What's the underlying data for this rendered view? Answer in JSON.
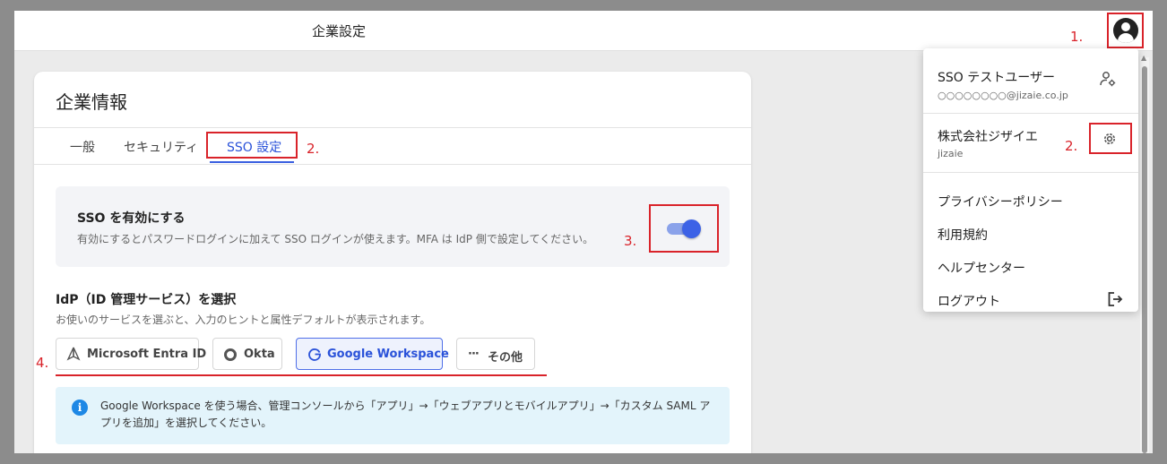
{
  "header": {
    "title": "企業設定"
  },
  "card": {
    "title": "企業情報",
    "tabs": [
      {
        "label": "一般",
        "active": false
      },
      {
        "label": "セキュリティ",
        "active": false
      },
      {
        "label": "SSO 設定",
        "active": true
      }
    ]
  },
  "sso": {
    "enable_title": "SSO を有効にする",
    "enable_description": "有効にするとパスワードログインに加えて SSO ログインが使えます。MFA は IdP 側で設定してください。",
    "enabled": true
  },
  "idp": {
    "title": "IdP（ID 管理サービス）を選択",
    "description": "お使いのサービスを選ぶと、入力のヒントと属性デフォルトが表示されます。",
    "options": [
      {
        "label": "Microsoft Entra ID",
        "selected": false
      },
      {
        "label": "Okta",
        "selected": false
      },
      {
        "label": "Google Workspace",
        "selected": true
      },
      {
        "label": "その他",
        "selected": false
      }
    ],
    "other_prefix": "···"
  },
  "info": {
    "text": "Google Workspace を使う場合、管理コンソールから「アプリ」→「ウェブアプリとモバイルアプリ」→「カスタム SAML アプリを追加」を選択してください。",
    "icon": "info-icon"
  },
  "user_menu": {
    "user_name": "SSO テストユーザー",
    "user_email": "○○○○○○○○@jizaie.co.jp",
    "company_name": "株式会社ジザイエ",
    "company_id": "jizaie",
    "items": [
      "プライバシーポリシー",
      "利用規約",
      "ヘルプセンター",
      "ログアウト"
    ]
  },
  "annotations": {
    "step1": "1.",
    "step2a": "2.",
    "step2b": "2.",
    "step3": "3.",
    "step4": "4."
  },
  "colors": {
    "accent": "#3c62e6",
    "annotation_red": "#d9232a",
    "info_bg": "#e3f4fb"
  }
}
